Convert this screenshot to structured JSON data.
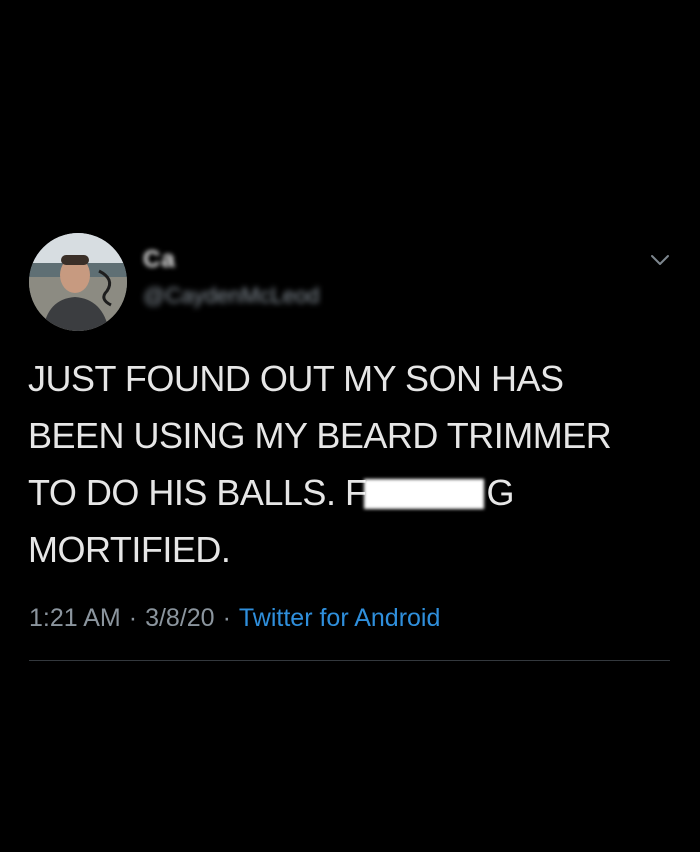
{
  "tweet": {
    "author": {
      "display_name": "Ca",
      "handle": "@CaydenMcLeod"
    },
    "menu_icon": "chevron-down-icon",
    "text_lines": [
      "JUST FOUND OUT MY SON HAS",
      "BEEN USING MY BEARD TRIMMER",
      "TO DO HIS BALLS. F"
    ],
    "text_line3_end": "G",
    "text_line4": "MORTIFIED.",
    "time": "1:21 AM",
    "date": "3/8/20",
    "separator": "·",
    "source": "Twitter for Android",
    "colors": {
      "background": "#000000",
      "text": "#e6e6e6",
      "meta": "#8b959e",
      "link": "#2f8fdc",
      "divider": "#33383d"
    }
  }
}
